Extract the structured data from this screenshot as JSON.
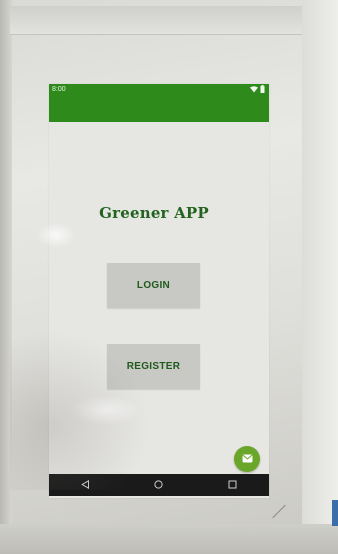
{
  "status_bar": {
    "time": "8:00",
    "wifi_icon": "wifi-icon",
    "battery_icon": "battery-icon",
    "color": "#2f8a1c"
  },
  "main": {
    "title": "Greener APP",
    "title_color": "#23631f",
    "login_label": "LOGIN",
    "register_label": "REGISTER"
  },
  "fab": {
    "icon": "message-icon",
    "color": "#6aa62a"
  },
  "nav_bar": {
    "back_icon": "back-triangle-icon",
    "home_icon": "home-circle-icon",
    "recents_icon": "recents-square-icon"
  }
}
